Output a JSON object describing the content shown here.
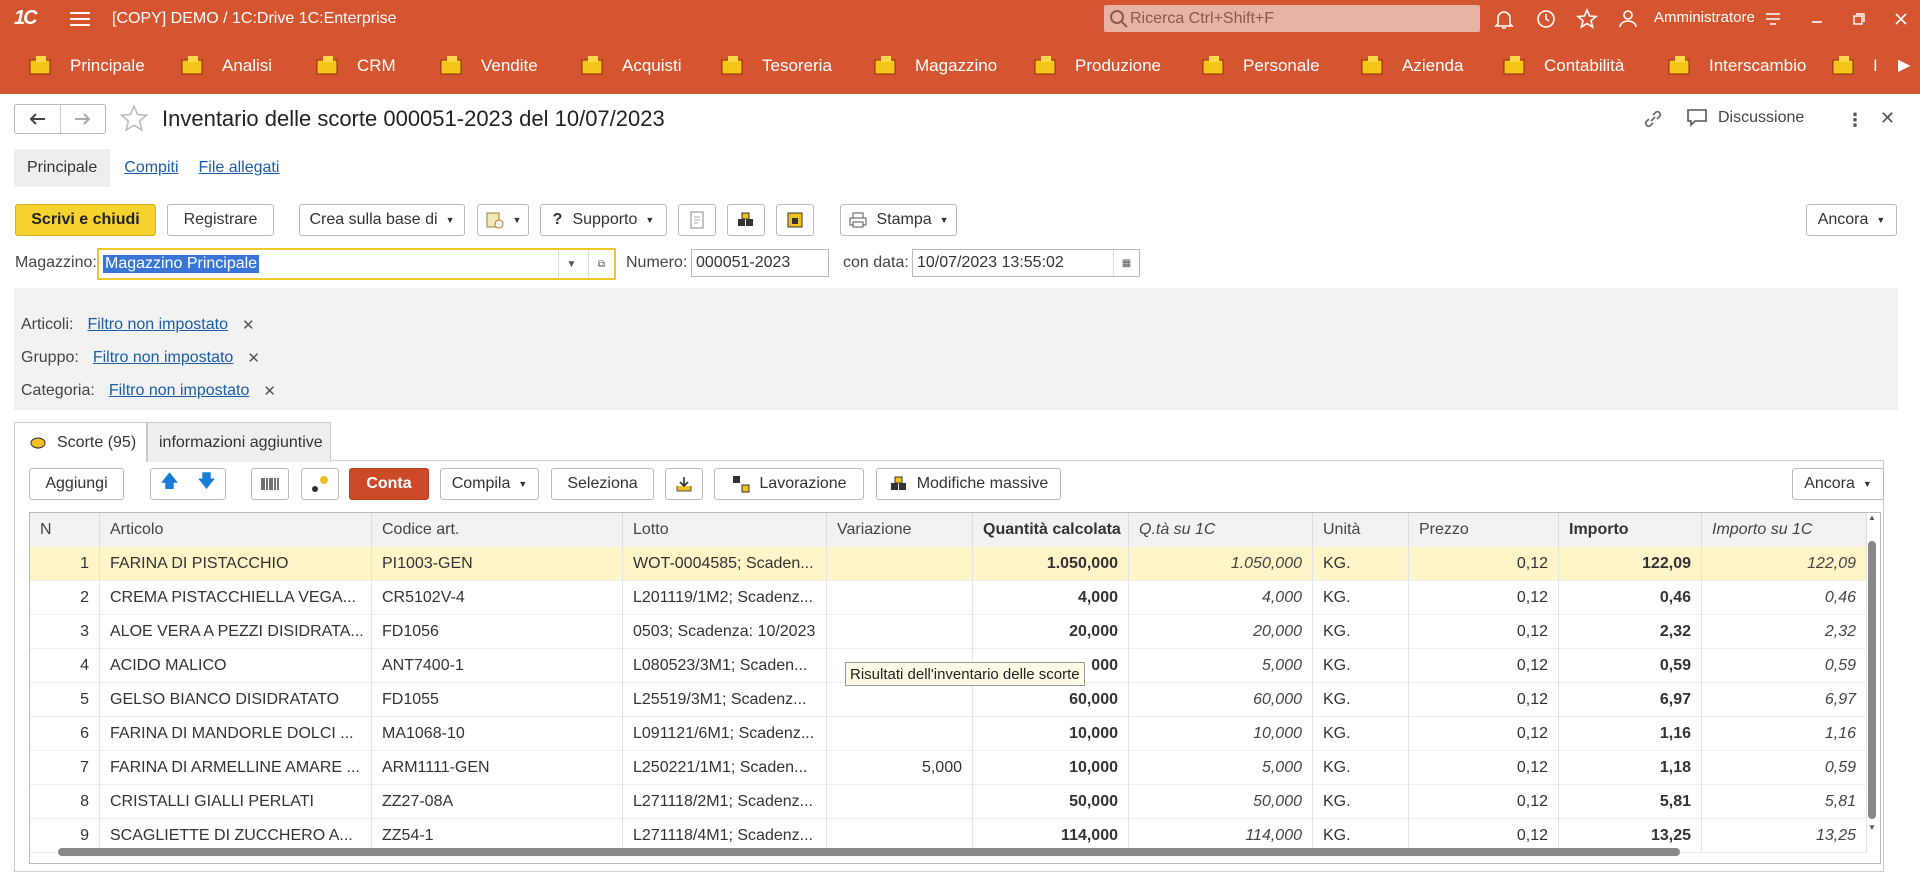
{
  "titlebar": {
    "logo": "1C",
    "title": "[COPY] DEMO / 1C:Drive 1C:Enterprise",
    "search_placeholder": "Ricerca Ctrl+Shift+F",
    "user": "Amministratore"
  },
  "sections": [
    {
      "label": "Principale",
      "icon": "home-cart-icon"
    },
    {
      "label": "Analisi",
      "icon": "chart-icon"
    },
    {
      "label": "CRM",
      "icon": "crm-list-icon"
    },
    {
      "label": "Vendite",
      "icon": "sales-cart-icon"
    },
    {
      "label": "Acquisti",
      "icon": "truck-icon"
    },
    {
      "label": "Tesoreria",
      "icon": "treasury-icon"
    },
    {
      "label": "Magazzino",
      "icon": "box-icon"
    },
    {
      "label": "Produzione",
      "icon": "factory-icon"
    },
    {
      "label": "Personale",
      "icon": "people-icon"
    },
    {
      "label": "Azienda",
      "icon": "company-icon"
    },
    {
      "label": "Contabilità",
      "icon": "ledger-icon"
    },
    {
      "label": "Interscambio",
      "icon": "cloud-exchange-icon"
    },
    {
      "label": "I",
      "icon": "grid-icon"
    }
  ],
  "form": {
    "title": "Inventario delle scorte 000051-2023 del 10/07/2023",
    "discussion": "Discussione",
    "tabs": [
      "Principale",
      "Compiti",
      "File allegati"
    ]
  },
  "toolbar": {
    "write_close": "Scrivi e chiudi",
    "register": "Registrare",
    "create_based": "Crea sulla base di",
    "support": "Supporto",
    "print": "Stampa",
    "more": "Ancora"
  },
  "fields": {
    "warehouse_label": "Magazzino:",
    "warehouse_value": "Magazzino Principale",
    "number_label": "Numero:",
    "number_value": "000051-2023",
    "date_label": "con data:",
    "date_value": "10/07/2023 13:55:02"
  },
  "filters": [
    {
      "label": "Articoli:",
      "value": "Filtro non impostato"
    },
    {
      "label": "Gruppo:",
      "value": "Filtro non impostato"
    },
    {
      "label": "Categoria:",
      "value": "Filtro non impostato"
    }
  ],
  "lower_tabs": {
    "stock": "Scorte (95)",
    "extra": "informazioni aggiuntive"
  },
  "table_toolbar": {
    "add": "Aggiungi",
    "count": "Conta",
    "fill": "Compila",
    "select": "Seleziona",
    "processing": "Lavorazione",
    "bulk_edit": "Modifiche massive",
    "more": "Ancora"
  },
  "table": {
    "columns": [
      "N",
      "Articolo",
      "Codice art.",
      "Lotto",
      "Variazione",
      "Quantità calcolata",
      "Q.tà su 1C",
      "Unità",
      "Prezzo",
      "Importo",
      "Importo su 1C"
    ],
    "rows": [
      [
        "1",
        "FARINA DI PISTACCHIO",
        "PI1003-GEN",
        "WOT-0004585; Scaden...",
        "",
        "1.050,000",
        "1.050,000",
        "KG.",
        "0,12",
        "122,09",
        "122,09"
      ],
      [
        "2",
        "CREMA PISTACCHIELLA VEGA...",
        "CR5102V-4",
        "L201119/1M2; Scadenz...",
        "",
        "4,000",
        "4,000",
        "KG.",
        "0,12",
        "0,46",
        "0,46"
      ],
      [
        "3",
        "ALOE VERA A PEZZI DISIDRATA...",
        "FD1056",
        "0503; Scadenza: 10/2023",
        "",
        "20,000",
        "20,000",
        "KG.",
        "0,12",
        "2,32",
        "2,32"
      ],
      [
        "4",
        "ACIDO MALICO",
        "ANT7400-1",
        "L080523/3M1; Scaden...",
        "",
        "000",
        "5,000",
        "KG.",
        "0,12",
        "0,59",
        "0,59"
      ],
      [
        "5",
        "GELSO BIANCO DISIDRATATO",
        "FD1055",
        "L25519/3M1; Scadenz...",
        "",
        "60,000",
        "60,000",
        "KG.",
        "0,12",
        "6,97",
        "6,97"
      ],
      [
        "6",
        "FARINA DI MANDORLE DOLCI ...",
        "MA1068-10",
        "L091121/6M1; Scadenz...",
        "",
        "10,000",
        "10,000",
        "KG.",
        "0,12",
        "1,16",
        "1,16"
      ],
      [
        "7",
        "FARINA DI ARMELLINE AMARE ...",
        "ARM1111-GEN",
        "L250221/1M1; Scaden...",
        "5,000",
        "10,000",
        "5,000",
        "KG.",
        "0,12",
        "1,18",
        "0,59"
      ],
      [
        "8",
        "CRISTALLI GIALLI PERLATI",
        "ZZ27-08A",
        "L271118/2M1; Scadenz...",
        "",
        "50,000",
        "50,000",
        "KG.",
        "0,12",
        "5,81",
        "5,81"
      ],
      [
        "9",
        "SCAGLIETTE DI ZUCCHERO A...",
        "ZZ54-1",
        "L271118/4M1; Scadenz...",
        "",
        "114,000",
        "114,000",
        "KG.",
        "0,12",
        "13,25",
        "13,25"
      ]
    ]
  },
  "tooltip": "Risultati dell'inventario delle scorte"
}
